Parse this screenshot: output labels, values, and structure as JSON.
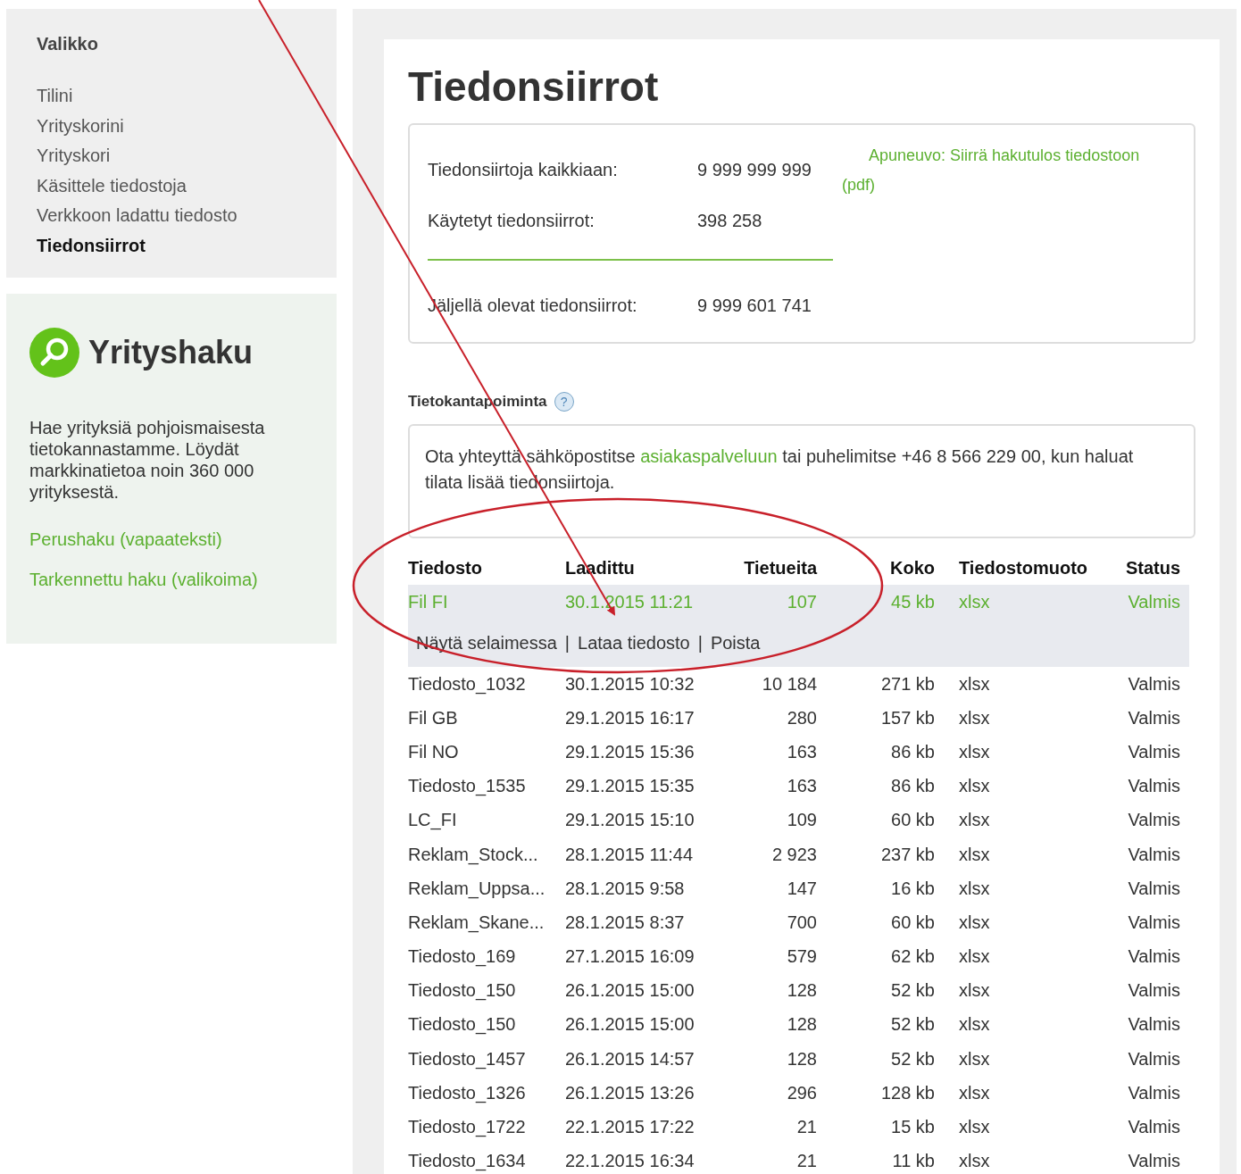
{
  "menu": {
    "title": "Valikko",
    "items": [
      {
        "label": "Tilini",
        "selected": false
      },
      {
        "label": "Yrityskorini",
        "selected": false
      },
      {
        "label": "Yrityskori",
        "selected": false
      },
      {
        "label": "Käsittele tiedostoja",
        "selected": false
      },
      {
        "label": "Verkkoon ladattu tiedosto",
        "selected": false
      },
      {
        "label": "Tiedonsiirrot",
        "selected": true
      }
    ]
  },
  "search_panel": {
    "title": "Yrityshaku",
    "description": "Hae yrityksiä pohjoismaisesta tietokannastamme. Löydät markkinatietoa noin 360 000 yrityksestä.",
    "links": [
      "Perushaku (vapaateksti)",
      "Tarkennettu haku (valikoima)"
    ]
  },
  "page_title": "Tiedonsiirrot",
  "summary": {
    "rows": [
      {
        "label": "Tiedonsiirtoja kaikkiaan:",
        "value": "9 999 999 999"
      },
      {
        "label": "Käytetyt tiedonsiirrot:",
        "value": "398 258"
      },
      {
        "label": "Jäljellä olevat tiedonsiirrot:",
        "value": "9 999 601 741"
      }
    ],
    "tool_link": "Apuneuvo: Siirrä hakutulos tiedostoon",
    "tool_format": "(pdf)"
  },
  "database_extract": {
    "title": "Tietokantapoiminta",
    "help": "?",
    "notice_before": "Ota yhteyttä sähköpostitse",
    "notice_link": "asiakaspalveluun",
    "notice_after": "tai puhelimitse +46 8 566 229 00, kun haluat tilata lisää tiedonsiirtoja."
  },
  "table": {
    "columns": [
      "Tiedosto",
      "Laadittu",
      "Tietueita",
      "Koko",
      "Tiedostomuoto",
      "Status"
    ],
    "rows": [
      {
        "cells": [
          "Fil FI",
          "30.1.2015 11:21",
          "107",
          "45 kb",
          "xlsx",
          "Valmis"
        ],
        "selected": true,
        "actions": [
          "Näytä selaimessa",
          "Lataa tiedosto",
          "Poista"
        ],
        "separator": "|"
      },
      {
        "cells": [
          "Tiedosto_1032",
          "30.1.2015 10:32",
          "10 184",
          "271 kb",
          "xlsx",
          "Valmis"
        ],
        "selected": false
      },
      {
        "cells": [
          "Fil GB",
          "29.1.2015 16:17",
          "280",
          "157 kb",
          "xlsx",
          "Valmis"
        ],
        "selected": false
      },
      {
        "cells": [
          "Fil NO",
          "29.1.2015 15:36",
          "163",
          "86 kb",
          "xlsx",
          "Valmis"
        ],
        "selected": false
      },
      {
        "cells": [
          "Tiedosto_1535",
          "29.1.2015 15:35",
          "163",
          "86 kb",
          "xlsx",
          "Valmis"
        ],
        "selected": false
      },
      {
        "cells": [
          "LC_FI",
          "29.1.2015 15:10",
          "109",
          "60 kb",
          "xlsx",
          "Valmis"
        ],
        "selected": false
      },
      {
        "cells": [
          "Reklam_Stock...",
          "28.1.2015 11:44",
          "2 923",
          "237 kb",
          "xlsx",
          "Valmis"
        ],
        "selected": false
      },
      {
        "cells": [
          "Reklam_Uppsa...",
          "28.1.2015 9:58",
          "147",
          "16 kb",
          "xlsx",
          "Valmis"
        ],
        "selected": false
      },
      {
        "cells": [
          "Reklam_Skane...",
          "28.1.2015 8:37",
          "700",
          "60 kb",
          "xlsx",
          "Valmis"
        ],
        "selected": false
      },
      {
        "cells": [
          "Tiedosto_169",
          "27.1.2015 16:09",
          "579",
          "62 kb",
          "xlsx",
          "Valmis"
        ],
        "selected": false
      },
      {
        "cells": [
          "Tiedosto_150",
          "26.1.2015 15:00",
          "128",
          "52 kb",
          "xlsx",
          "Valmis"
        ],
        "selected": false
      },
      {
        "cells": [
          "Tiedosto_150",
          "26.1.2015 15:00",
          "128",
          "52 kb",
          "xlsx",
          "Valmis"
        ],
        "selected": false
      },
      {
        "cells": [
          "Tiedosto_1457",
          "26.1.2015 14:57",
          "128",
          "52 kb",
          "xlsx",
          "Valmis"
        ],
        "selected": false
      },
      {
        "cells": [
          "Tiedosto_1326",
          "26.1.2015 13:26",
          "296",
          "128 kb",
          "xlsx",
          "Valmis"
        ],
        "selected": false
      },
      {
        "cells": [
          "Tiedosto_1722",
          "22.1.2015 17:22",
          "21",
          "15 kb",
          "xlsx",
          "Valmis"
        ],
        "selected": false
      },
      {
        "cells": [
          "Tiedosto_1634",
          "22.1.2015 16:34",
          "21",
          "11 kb",
          "xlsx",
          "Valmis"
        ],
        "selected": false
      }
    ]
  }
}
